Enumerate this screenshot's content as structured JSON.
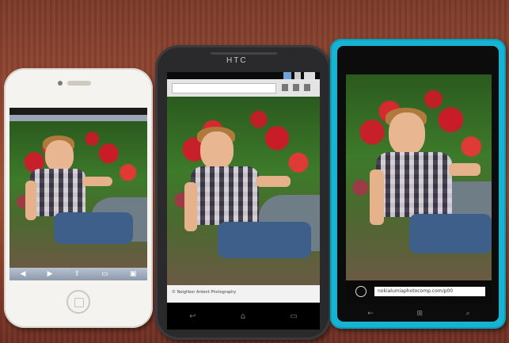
{
  "scene": {
    "devices": [
      {
        "id": "iphone",
        "model": "iPhone (white)",
        "color": "#f4f3ef"
      },
      {
        "id": "htc",
        "model": "HTC One X",
        "brand_text": "HTC",
        "color": "#2a2a2c"
      },
      {
        "id": "lumia",
        "model": "Nokia Lumia (cyan)",
        "color": "#17b3d3"
      }
    ],
    "table_color": "#9a4a33"
  },
  "htc": {
    "brand": "HTC",
    "caption": "© Neighbor Ardent Photography"
  },
  "lumia": {
    "url": "nokialumiaphotocomp.com/p00"
  },
  "icons": [
    "home-button",
    "back-icon",
    "home-icon",
    "menu-icon",
    "search-icon",
    "refresh-icon"
  ]
}
